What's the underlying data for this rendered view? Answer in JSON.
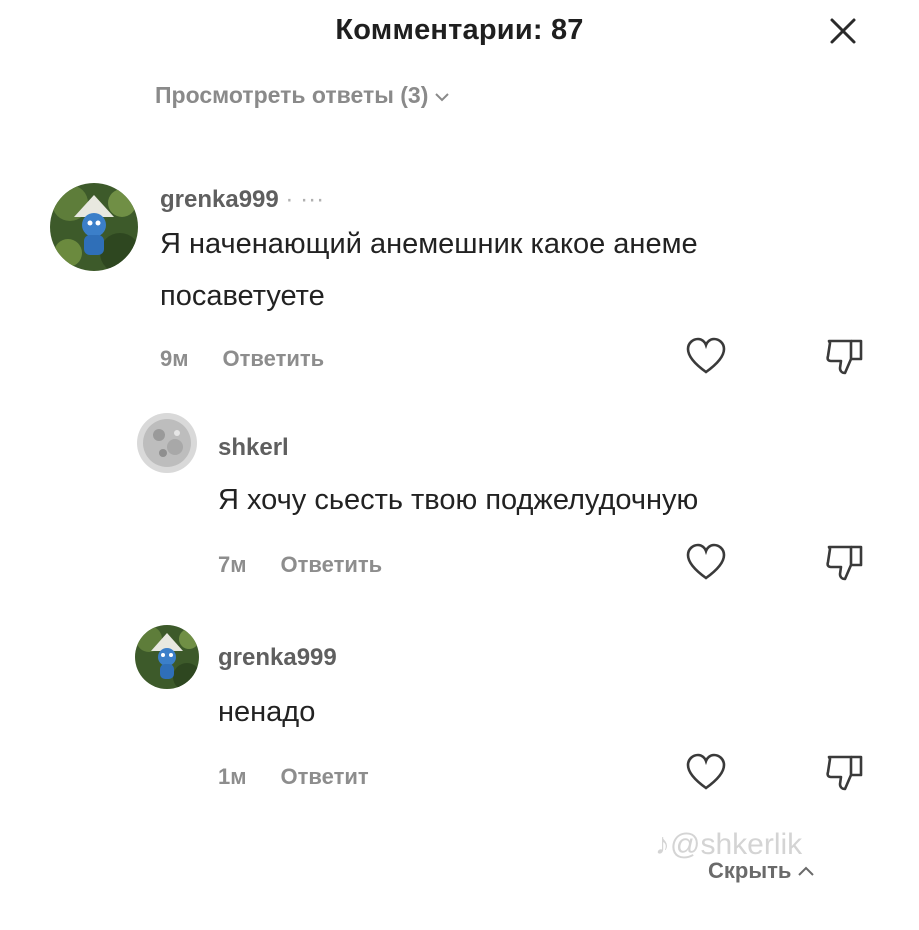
{
  "header": {
    "title": "Комментарии: 87"
  },
  "view_replies": {
    "label": "Просмотреть ответы (3)"
  },
  "comments": [
    {
      "username": "grenka999",
      "username_suffix": "· ···",
      "text_line1": "Я наченающий анемешник какое анеме",
      "text_line2": "посаветуете",
      "time": "9м",
      "reply_label": "Ответить"
    },
    {
      "username": "shkerl",
      "text_line1": "Я хочу сьесть твою поджелудочную",
      "time": "7м",
      "reply_label": "Ответить"
    },
    {
      "username": "grenka999",
      "text_line1": "ненадо",
      "time": "1м",
      "reply_label": "Ответит"
    }
  ],
  "footer": {
    "watermark": "♪@shkerlik",
    "hide_label": "Скрыть"
  },
  "colors": {
    "background": "#ffffff",
    "text": "#222222",
    "muted": "#8d8d8d"
  }
}
